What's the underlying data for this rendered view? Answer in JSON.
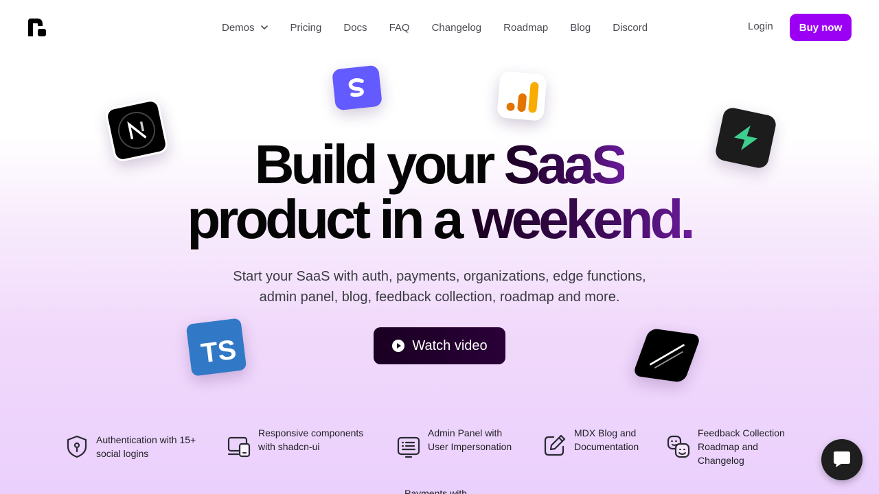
{
  "nav": {
    "items": [
      {
        "label": "Demos",
        "has_dropdown": true
      },
      {
        "label": "Pricing"
      },
      {
        "label": "Docs"
      },
      {
        "label": "FAQ"
      },
      {
        "label": "Changelog"
      },
      {
        "label": "Roadmap"
      },
      {
        "label": "Blog"
      },
      {
        "label": "Discord"
      }
    ],
    "login": "Login",
    "buy": "Buy now"
  },
  "hero": {
    "line1_a": "Build your ",
    "line1_b": "SaaS",
    "line2_a": "product in a ",
    "line2_b": "weekend.",
    "subtitle_1": "Start your SaaS with auth, payments, organizations, edge functions,",
    "subtitle_2": "admin panel, blog, feedback collection, roadmap and more.",
    "cta": "Watch video"
  },
  "floating_icons": [
    "nextjs-logo",
    "stripe-logo",
    "google-analytics-logo",
    "supabase-logo",
    "typescript-logo",
    "resend-logo"
  ],
  "features": [
    {
      "text": "Authentication with 15+ social logins",
      "icon": "shield-key-icon"
    },
    {
      "text": "Responsive components with shadcn-ui",
      "icon": "devices-icon"
    },
    {
      "text": "Admin Panel with User Impersonation",
      "icon": "admin-panel-icon"
    },
    {
      "text": "MDX Blog and Documentation",
      "icon": "edit-icon"
    },
    {
      "text": "Feedback Collection Roadmap and Changelog",
      "icon": "mood-icon"
    },
    {
      "text": "Payments with",
      "icon": ""
    }
  ],
  "colors": {
    "accent": "#9b00f5",
    "cta_bg": "#1a0022"
  }
}
